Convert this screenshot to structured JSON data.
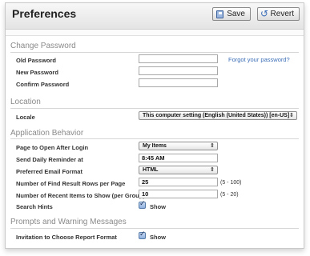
{
  "header": {
    "title": "Preferences",
    "save_label": "Save",
    "revert_label": "Revert"
  },
  "sections": {
    "password": {
      "title": "Change Password",
      "old_label": "Old Password",
      "new_label": "New Password",
      "confirm_label": "Confirm Password",
      "forgot_link": "Forgot your password?"
    },
    "location": {
      "title": "Location",
      "locale_label": "Locale",
      "locale_value": "This computer setting (English (United States)) [en-US]"
    },
    "behavior": {
      "title": "Application Behavior",
      "page_label": "Page to Open After Login",
      "page_value": "My Items",
      "reminder_label": "Send Daily Reminder at",
      "reminder_value": "8:45 AM",
      "email_label": "Preferred Email Format",
      "email_value": "HTML",
      "find_rows_label": "Number of Find Result Rows per Page",
      "find_rows_value": "25",
      "find_rows_range": "(5 - 100)",
      "recent_label": "Number of Recent Items to Show (per Group)",
      "recent_value": "10",
      "recent_range": "(5 - 20)",
      "hints_label": "Search Hints",
      "hints_show": "Show",
      "hints_checked": true
    },
    "prompts": {
      "title": "Prompts and Warning Messages",
      "invite_label": "Invitation to Choose Report Format",
      "invite_show": "Show",
      "invite_checked": true
    }
  },
  "icons": {
    "save": "save-icon",
    "revert": "revert-icon",
    "checkbox": "checkmark-icon",
    "select_arrow": "updown-arrow-icon"
  }
}
